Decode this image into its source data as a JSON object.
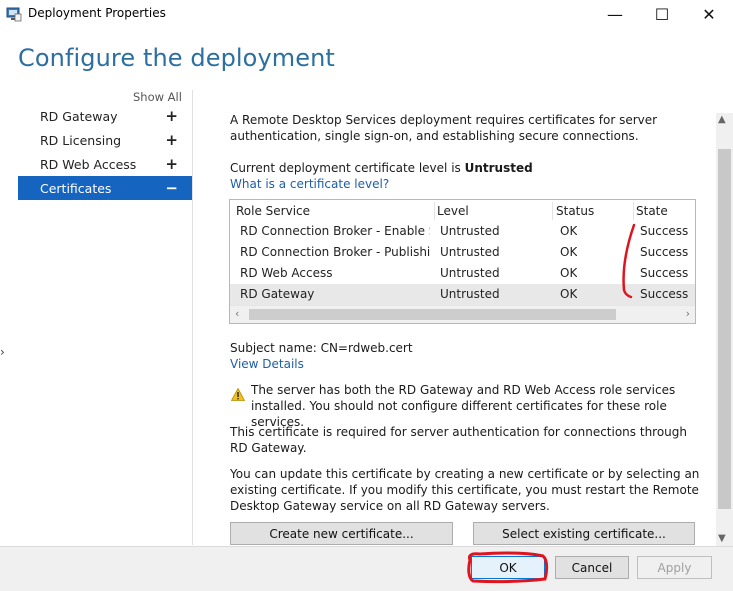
{
  "window": {
    "title": "Deployment Properties",
    "minimize_glyph": "—",
    "maximize_glyph": "☐",
    "close_glyph": "✕"
  },
  "page_title": "Configure the deployment",
  "nav": {
    "show_all": "Show All",
    "items": [
      {
        "label": "RD Gateway",
        "sign": "+"
      },
      {
        "label": "RD Licensing",
        "sign": "+"
      },
      {
        "label": "RD Web Access",
        "sign": "+"
      },
      {
        "label": "Certificates",
        "sign": "−"
      }
    ]
  },
  "content": {
    "intro": "A Remote Desktop Services deployment requires certificates for server authentication, single sign-on, and establishing secure connections.",
    "level_prefix": "Current deployment certificate level is ",
    "level_value": "Untrusted",
    "level_link": "What is a certificate level?",
    "table": {
      "headers": [
        "Role Service",
        "Level",
        "Status",
        "State"
      ],
      "rows": [
        [
          "RD Connection Broker - Enable Sing",
          "Untrusted",
          "OK",
          "Success"
        ],
        [
          "RD Connection Broker - Publishing",
          "Untrusted",
          "OK",
          "Success"
        ],
        [
          "RD Web Access",
          "Untrusted",
          "OK",
          "Success"
        ],
        [
          "RD Gateway",
          "Untrusted",
          "OK",
          "Success"
        ]
      ]
    },
    "subject_name": "Subject name: CN=rdweb.cert",
    "view_details": "View Details",
    "warning": "The server has both the RD Gateway and RD Web Access role services installed. You should not configure different certificates for these role services.",
    "required_note": "This certificate is required for server authentication for connections through RD Gateway.",
    "update_note": "You can update this certificate by creating a new certificate or by selecting an existing certificate. If you modify this certificate, you must restart the Remote Desktop Gateway service on all RD Gateway servers.",
    "create_button": "Create new certificate...",
    "select_button": "Select existing certificate..."
  },
  "footer": {
    "ok": "OK",
    "cancel": "Cancel",
    "apply": "Apply"
  },
  "colors": {
    "accent": "#1565c0",
    "title": "#2c6fa0",
    "link": "#1f5ea8",
    "annotation": "#e0141e"
  }
}
